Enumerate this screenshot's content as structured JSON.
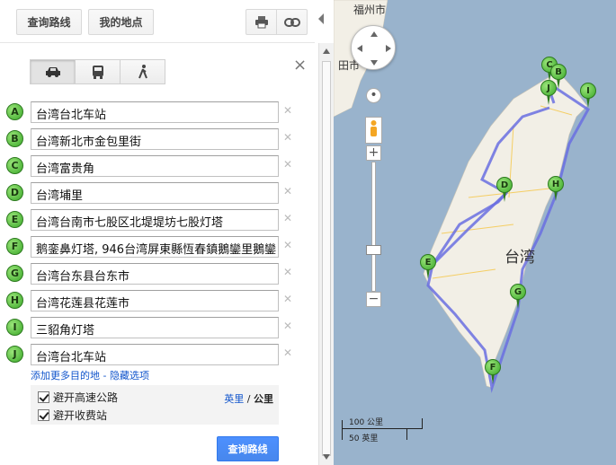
{
  "toolbar": {
    "directions_label": "查询路线",
    "my_places_label": "我的地点"
  },
  "travel_modes": [
    "driving",
    "transit",
    "walking"
  ],
  "waypoints": [
    {
      "marker": "A",
      "value": "台湾台北车站"
    },
    {
      "marker": "B",
      "value": "台湾新北市金包里街"
    },
    {
      "marker": "C",
      "value": "台湾富贵角"
    },
    {
      "marker": "D",
      "value": "台湾埔里"
    },
    {
      "marker": "E",
      "value": "台湾台南市七股区北堤堤坊七股灯塔"
    },
    {
      "marker": "F",
      "value": "鹅銮鼻灯塔, 946台湾屏東縣恆春鎮鵝鑾里鵝鑾"
    },
    {
      "marker": "G",
      "value": "台湾台东县台东市"
    },
    {
      "marker": "H",
      "value": "台湾花莲县花莲市"
    },
    {
      "marker": "I",
      "value": "三貂角灯塔"
    },
    {
      "marker": "J",
      "value": "台湾台北车站"
    }
  ],
  "links": {
    "add_destination": "添加更多目的地",
    "separator": " - ",
    "hide_options": "隐藏选项"
  },
  "options": {
    "avoid_highways": "避开高速公路",
    "avoid_tolls": "避开收费站",
    "unit_miles": "英里",
    "unit_sep": " / ",
    "unit_km": "公里"
  },
  "submit_label": "查询路线",
  "map": {
    "label_fuzhou": "福州市",
    "label_putian": "田市",
    "label_taiwan": "台湾",
    "scale_km": "100 公里",
    "scale_mi": "50 英里",
    "pins": [
      "C",
      "B",
      "J",
      "I",
      "D",
      "H",
      "E",
      "G",
      "F"
    ],
    "sea_color": "#99b3cc",
    "land_color": "#f2efe6",
    "route_color": "#6a6fe0"
  }
}
